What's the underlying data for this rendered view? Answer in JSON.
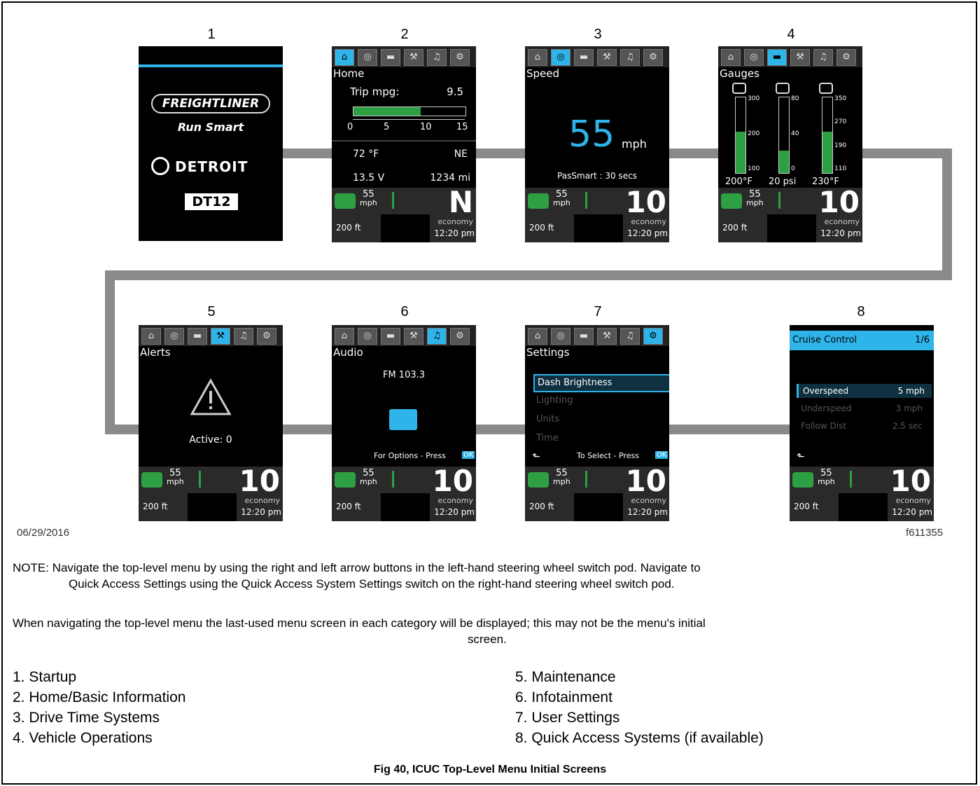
{
  "panels": [
    {
      "num": "1"
    },
    {
      "num": "2",
      "title": "Home",
      "trip_label": "Trip mpg:",
      "trip_value": "9.5",
      "scale": [
        "0",
        "5",
        "10",
        "15"
      ],
      "temp": "72 °F",
      "dir": "NE",
      "volt": "13.5 V",
      "miles": "1234 mi"
    },
    {
      "num": "3",
      "title": "Speed",
      "speed": "55",
      "unit": "mph",
      "passmart": "PasSmart : 30 secs"
    },
    {
      "num": "4",
      "title": "Gauges",
      "ticks": [
        [
          "300",
          "200",
          "100"
        ],
        [
          "80",
          "40",
          "0"
        ],
        [
          "350",
          "270",
          "190",
          "110"
        ]
      ],
      "readings": [
        "200°F",
        "20 psi",
        "230°F"
      ]
    },
    {
      "num": "5",
      "title": "Alerts",
      "active": "Active: 0"
    },
    {
      "num": "6",
      "title": "Audio",
      "station": "FM 103.3",
      "options": "For Options - Press",
      "ok": "OK"
    },
    {
      "num": "7",
      "title": "Settings",
      "items": [
        "Dash Brightness",
        "Lighting",
        "Units",
        "Time"
      ],
      "select": "To Select - Press",
      "ok": "OK"
    },
    {
      "num": "8",
      "title": "Cruise Control",
      "page": "1/6",
      "rows": [
        [
          "Overspeed",
          "5 mph"
        ],
        [
          "Underspeed",
          "3 mph"
        ],
        [
          "Follow Dist",
          "2.5 sec"
        ]
      ]
    }
  ],
  "startup": {
    "brand": "FREIGHTLINER",
    "tagline": "Run Smart",
    "maker": "DETROIT",
    "engine": "DT12"
  },
  "footer": {
    "speed": "55",
    "unit": "mph",
    "gear_home": "N",
    "gear": "10",
    "distance": "200 ft",
    "mode": "economy",
    "time": "12:20 pm"
  },
  "date": "06/29/2016",
  "figure_id": "f611355",
  "note_line1": "NOTE:  Navigate the top-level menu by using the right and left arrow buttons in the left-hand steering wheel switch pod. Navigate to",
  "note_line2": "Quick Access Settings using the Quick Access System Settings switch on the right-hand steering wheel switch pod.",
  "para_line1": "When navigating the top-level menu the last-used menu screen in each category will be displayed; this may not be the menu's initial",
  "para_line2": "screen.",
  "legend": [
    "1.  Startup",
    "2.  Home/Basic Information",
    "3.  Drive Time Systems",
    "4.  Vehicle Operations",
    "5.  Maintenance",
    "6.  Infotainment",
    "7.  User Settings",
    "8.  Quick Access Systems (if available)"
  ],
  "caption": "Fig 40, ICUC Top-Level Menu Initial Screens",
  "colors": {
    "accent": "#2fb4ea",
    "gauge_green": "#2ea043",
    "connector": "#8a8a8a"
  }
}
